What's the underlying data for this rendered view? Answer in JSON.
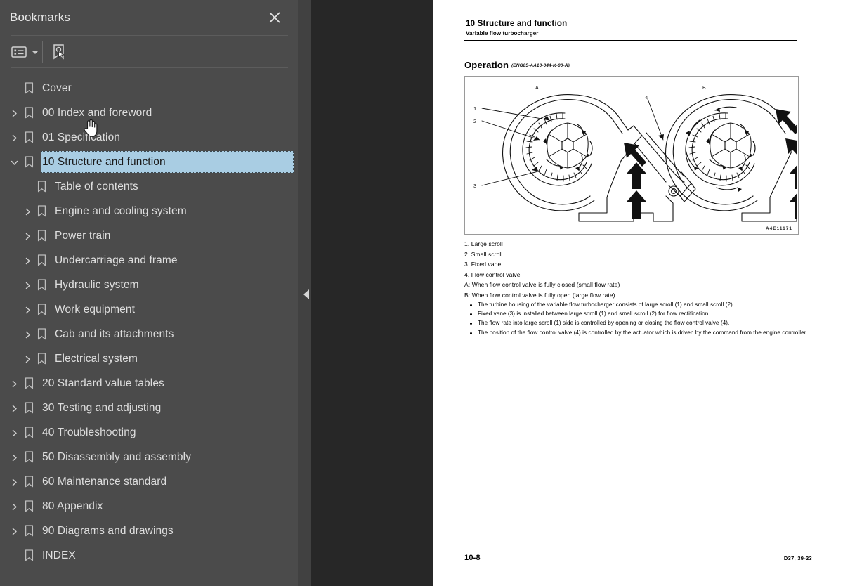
{
  "sidebar": {
    "title": "Bookmarks",
    "close_icon": "close-icon",
    "toolbar": {
      "options_icon": "list-options-icon",
      "dropdown_icon": "chevron-down-icon",
      "new_bookmark_icon": "new-bookmark-icon"
    },
    "items": [
      {
        "label": "Cover",
        "depth": 0,
        "twisty": "none",
        "selected": false
      },
      {
        "label": "00 Index and foreword",
        "depth": 0,
        "twisty": "collapsed",
        "selected": false
      },
      {
        "label": "01 Specification",
        "depth": 0,
        "twisty": "collapsed",
        "selected": false
      },
      {
        "label": "10 Structure and function",
        "depth": 0,
        "twisty": "expanded",
        "selected": true
      },
      {
        "label": "Table of contents",
        "depth": 1,
        "twisty": "none",
        "selected": false
      },
      {
        "label": "Engine and cooling system",
        "depth": 1,
        "twisty": "collapsed",
        "selected": false
      },
      {
        "label": "Power train",
        "depth": 1,
        "twisty": "collapsed",
        "selected": false
      },
      {
        "label": "Undercarriage and frame",
        "depth": 1,
        "twisty": "collapsed",
        "selected": false
      },
      {
        "label": "Hydraulic system",
        "depth": 1,
        "twisty": "collapsed",
        "selected": false
      },
      {
        "label": "Work equipment",
        "depth": 1,
        "twisty": "collapsed",
        "selected": false
      },
      {
        "label": "Cab and its attachments",
        "depth": 1,
        "twisty": "collapsed",
        "selected": false
      },
      {
        "label": "Electrical system",
        "depth": 1,
        "twisty": "collapsed",
        "selected": false
      },
      {
        "label": "20 Standard value tables",
        "depth": 0,
        "twisty": "collapsed",
        "selected": false
      },
      {
        "label": "30 Testing and adjusting",
        "depth": 0,
        "twisty": "collapsed",
        "selected": false
      },
      {
        "label": "40 Troubleshooting",
        "depth": 0,
        "twisty": "collapsed",
        "selected": false
      },
      {
        "label": "50 Disassembly and assembly",
        "depth": 0,
        "twisty": "collapsed",
        "selected": false
      },
      {
        "label": "60 Maintenance standard",
        "depth": 0,
        "twisty": "collapsed",
        "selected": false
      },
      {
        "label": "80 Appendix",
        "depth": 0,
        "twisty": "collapsed",
        "selected": false
      },
      {
        "label": "90 Diagrams and drawings",
        "depth": 0,
        "twisty": "collapsed",
        "selected": false
      },
      {
        "label": "INDEX",
        "depth": 0,
        "twisty": "none",
        "selected": false
      }
    ]
  },
  "viewer": {
    "collapse_handle_icon": "triangle-left-icon",
    "cursor_icon": "pointing-hand-cursor"
  },
  "page": {
    "header_title": "10 Structure and function",
    "header_subtitle": "Variable flow turbocharger",
    "section_title": "Operation",
    "section_code": "(ENG85-AA10-044-K-00-A)",
    "figure": {
      "label_a": "A",
      "label_b": "B",
      "callouts": [
        "1",
        "2",
        "3",
        "4"
      ],
      "drawing_code": "A4E11171"
    },
    "legend": [
      "1. Large scroll",
      "2. Small scroll",
      "3. Fixed vane",
      "4. Flow control valve",
      "A: When flow control valve is fully closed (small flow rate)",
      "B: When flow control valve is fully open (large flow rate)"
    ],
    "bullets": [
      "The turbine housing of the variable flow turbocharger consists of large scroll (1) and small scroll (2).",
      "Fixed vane (3) is installed between large scroll (1) and small scroll (2) for flow rectification.",
      "The flow rate into large scroll (1) side is controlled by opening or closing the flow control valve (4).",
      "The position of the flow control valve (4) is controlled by the actuator which is driven by the command from the engine controller."
    ],
    "footer_left": "10-8",
    "footer_right": "D37, 39-23"
  },
  "colors": {
    "sidebar_bg": "#4b4b4b",
    "strip_bg": "#414141",
    "viewer_bg": "#272727",
    "selection": "#a9cde3",
    "text": "#dedede"
  }
}
